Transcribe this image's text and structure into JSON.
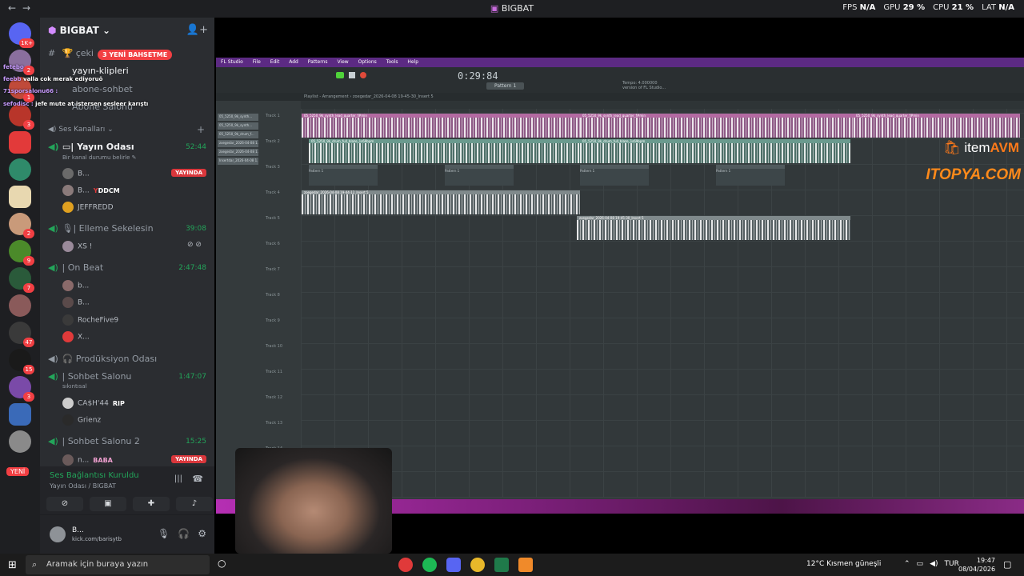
{
  "window": {
    "title": "BIGBAT",
    "back": "←",
    "forward": "→"
  },
  "stats": {
    "fps_label": "FPS",
    "fps": "N/A",
    "gpu_label": "GPU",
    "gpu": "29 %",
    "cpu_label": "CPU",
    "cpu": "21 %",
    "lat_label": "LAT",
    "lat": "N/A"
  },
  "server": {
    "name": "BIGBAT ⌄",
    "invite": "👤+"
  },
  "rail": {
    "badges": [
      "1K+",
      "2",
      "1",
      "3",
      "2",
      "9",
      "7",
      "47",
      "15",
      "3"
    ],
    "new_label": "YENİ"
  },
  "alert_pill": "3 YENİ BAHSETME",
  "chat": [
    {
      "name": "fetebo",
      "text": ""
    },
    {
      "name": "feebb",
      "text": "valla cok merak ediyoruö"
    },
    {
      "name": "71sporsalonu66 :",
      "text": ""
    },
    {
      "name": "sefodisc :",
      "text": "jefe mute at istersen sesleer karıştı"
    }
  ],
  "channels": {
    "cekilis": "çeki",
    "klipler": "yayın-klipleri",
    "abone_sohbet": "abone-sohbet",
    "abone_salonu": "Abone Salonu",
    "ses_kanallari": "Ses Kanalları",
    "yayin_odasi": "| Yayın Odası",
    "yayin_time": "52:44",
    "status_hint": "Bir kanal durumu belirle ✎",
    "elleme": "| Elleme Sekelesin",
    "elleme_time": "39:08",
    "onbeat": "| On Beat",
    "onbeat_time": "2:47:48",
    "produksiyon": "Prodüksiyon Odası",
    "sohbet": "| Sohbet Salonu",
    "sohbet_time": "1:47:07",
    "sohbet_sub": "sıkıntısal",
    "sohbet2": "| Sohbet Salonu 2",
    "sohbet2_time": "15:25"
  },
  "users": {
    "u1": "B...",
    "u1_badge": "YAYINDA",
    "u2": "B...",
    "u2_tag": "DDCM",
    "u3": "JEFFREDD",
    "u4": "XS !",
    "u5": "b...",
    "u6": "B...",
    "u7": "RocheFive9",
    "u8": "X...",
    "u9": "CA$H'44",
    "u9_tag": "RIP",
    "u10": "Grienz",
    "u11": "n...",
    "u11_tag": "BABA",
    "u11_badge": "YAYINDA"
  },
  "voice": {
    "status": "Ses Bağlantısı Kuruldu",
    "sub": "Yayın Odası / BIGBAT"
  },
  "me": {
    "name": "B...",
    "status": "kick.com/barisytb"
  },
  "fl": {
    "menu": [
      "FL Studio",
      "File",
      "Edit",
      "Add",
      "Patterns",
      "View",
      "Options",
      "Tools",
      "Help"
    ],
    "time": "0:29:84",
    "pattern": "Pattern 1",
    "hint_1": "Tempo: 4.000000",
    "hint_2": "version of FL Studio...",
    "playlist": "Playlist - Arrangement › zoegedar_2026-04-08 19-45-30_Insert 5",
    "picker": [
      "05_5250_9k_synth...",
      "05_5250_9k_synth...",
      "05_5250_9k_drum_f...",
      "zoegedar_2026-04-08 1...",
      "zoegedar_2026-04-08 1...",
      "Insertdar_2026-04-08 1..."
    ],
    "tracks": [
      "Track 1",
      "Track 2",
      "Track 3",
      "Track 4",
      "Track 5",
      "Track 6",
      "Track 7",
      "Track 8",
      "Track 9",
      "Track 10",
      "Track 11",
      "Track 12",
      "Track 13",
      "Track 14"
    ],
    "clips": {
      "synth": "05_5250_9k_synth_lead_quarter_f#min",
      "drum": "05_5250_9k_drum_full_blaze_1s69bpm",
      "pattern": "Pattern 1",
      "insert5a": "zoegedar_2026-04-08 19-44-12_Insert 5",
      "insert5b": "zoegedar_2026-04-08 19-45-30_Insert 5"
    }
  },
  "sponsors": {
    "itemavm_a": "item",
    "itemavm_b": "AVM",
    "itopya": "ITOPYA.COM"
  },
  "taskbar": {
    "search": "Aramak için buraya yazın",
    "weather": "12°C  Kısmen güneşli",
    "lang": "TUR",
    "time": "19:47",
    "date": "08/04/2026"
  }
}
